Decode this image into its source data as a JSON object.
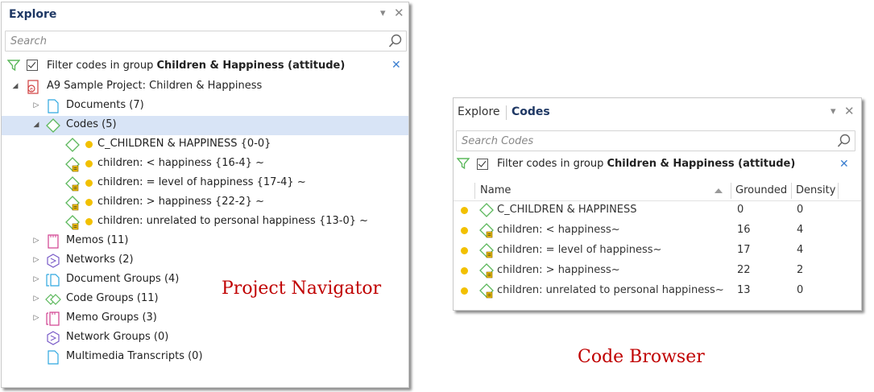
{
  "navigator": {
    "title": "Explore",
    "search_placeholder": "Search",
    "filter": {
      "prefix": "Filter codes in group ",
      "group": "Children & Happiness (attitude)"
    },
    "project": {
      "label": "A9 Sample Project: Children & Happiness",
      "icon": "project-icon"
    },
    "items": [
      {
        "label": "Documents (7)",
        "icon": "documents-icon"
      },
      {
        "label": "Codes (5)",
        "icon": "codes-icon"
      },
      {
        "label": "Memos (11)",
        "icon": "memos-icon"
      },
      {
        "label": "Networks (2)",
        "icon": "networks-icon"
      },
      {
        "label": "Document Groups (4)",
        "icon": "document-groups-icon"
      },
      {
        "label": "Code Groups (11)",
        "icon": "code-groups-icon"
      },
      {
        "label": "Memo Groups (3)",
        "icon": "memo-groups-icon"
      },
      {
        "label": "Network Groups (0)",
        "icon": "network-groups-icon"
      },
      {
        "label": "Multimedia Transcripts (0)",
        "icon": "multimedia-transcripts-icon"
      }
    ],
    "codes": [
      {
        "label": "C_CHILDREN & HAPPINESS {0-0}"
      },
      {
        "label": "children: < happiness {16-4} ~"
      },
      {
        "label": "children: = level of happiness {17-4} ~"
      },
      {
        "label": "children: > happiness {22-2} ~"
      },
      {
        "label": "children: unrelated to personal happiness {13-0} ~"
      }
    ]
  },
  "code_browser": {
    "tabs": [
      "Explore",
      "Codes"
    ],
    "search_placeholder": "Search Codes",
    "filter": {
      "prefix": "Filter codes in group ",
      "group": "Children & Happiness (attitude)"
    },
    "columns": {
      "name": "Name",
      "grounded": "Grounded",
      "density": "Density"
    },
    "rows": [
      {
        "name": "C_CHILDREN & HAPPINESS",
        "grounded": "0",
        "density": "0"
      },
      {
        "name": "children: < happiness~",
        "grounded": "16",
        "density": "4"
      },
      {
        "name": "children: = level of happiness~",
        "grounded": "17",
        "density": "4"
      },
      {
        "name": "children: > happiness~",
        "grounded": "22",
        "density": "2"
      },
      {
        "name": "children: unrelated to personal happiness~",
        "grounded": "13",
        "density": "0"
      }
    ]
  },
  "labels": {
    "project_navigator": "Project Navigator",
    "code_browser": "Code Browser"
  },
  "colors": {
    "accent": "#1f3864",
    "code_dot": "#f2c000",
    "filter_green": "#5cb85c",
    "annotation_red": "#c00000",
    "selection": "#d8e4f6"
  }
}
